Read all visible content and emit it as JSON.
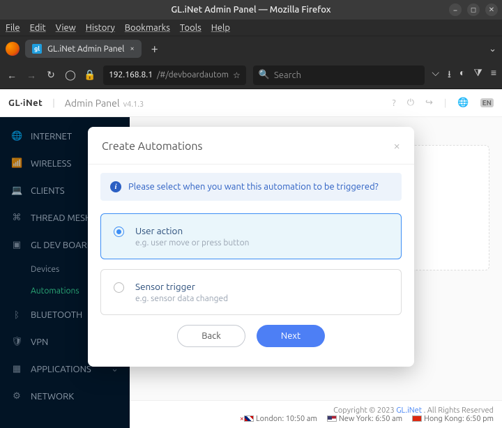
{
  "window": {
    "title": "GL.iNet Admin Panel — Mozilla Firefox"
  },
  "menubar": {
    "file": "File",
    "edit": "Edit",
    "view": "View",
    "history": "History",
    "bookmarks": "Bookmarks",
    "tools": "Tools",
    "help": "Help"
  },
  "tab": {
    "title": "GL.iNet Admin Panel",
    "close": "×",
    "newtab": "+"
  },
  "url": {
    "host": "192.168.8.1",
    "path": "/#/devboardautom",
    "search_placeholder": "Search"
  },
  "admin_header": {
    "logo": "GL·iNet",
    "divider": "|",
    "title": "Admin Panel",
    "version": "v4.1.3",
    "lang": "EN"
  },
  "sidebar": {
    "items": [
      {
        "icon": "🌐",
        "label": "INTERNET"
      },
      {
        "icon": "📶",
        "label": "WIRELESS"
      },
      {
        "icon": "💻",
        "label": "CLIENTS"
      },
      {
        "icon": "⌘",
        "label": "THREAD MESH"
      },
      {
        "icon": "▣",
        "label": "GL DEV BOARD"
      },
      {
        "icon": "ᛒ",
        "label": "BLUETOOTH"
      },
      {
        "icon": "🛡",
        "label": "VPN"
      },
      {
        "icon": "▦",
        "label": "APPLICATIONS"
      },
      {
        "icon": "⚙",
        "label": "NETWORK"
      }
    ],
    "subs": [
      {
        "label": "Devices",
        "active": false
      },
      {
        "label": "Automations",
        "active": true
      }
    ]
  },
  "footer": {
    "copyright": "Copyright © 2023 ",
    "brand": "GL.iNet",
    "rights": ". All Rights Reserved",
    "clocks": [
      {
        "flag": "uk",
        "city": "London:",
        "time": "10:50 am"
      },
      {
        "flag": "us",
        "city": "New York:",
        "time": "6:50 am"
      },
      {
        "flag": "hk",
        "city": "Hong Kong:",
        "time": "6:50 pm"
      }
    ]
  },
  "modal": {
    "title": "Create Automations",
    "info": "Please select when you want this automation to be triggered?",
    "options": [
      {
        "title": "User action",
        "sub": "e.g. user move or press button",
        "selected": true
      },
      {
        "title": "Sensor trigger",
        "sub": "e.g. sensor data changed",
        "selected": false
      }
    ],
    "back": "Back",
    "next": "Next"
  }
}
